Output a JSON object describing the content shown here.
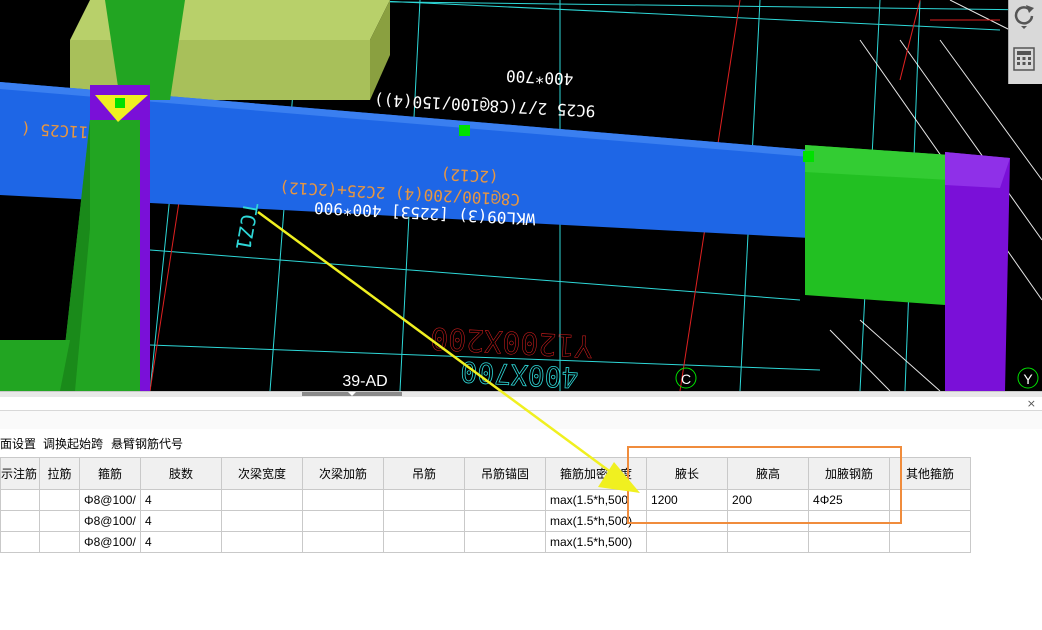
{
  "viewport": {
    "labels": {
      "beam_top_line1": "400*700",
      "beam_top_line2": "9C25 2/7(C8@100/150(4))",
      "beam_left_fragment": "11C25 (",
      "beam_mid_line1": "(2C12)",
      "beam_mid_line2": "C8@100/200(4) 2C25+(2C12)",
      "beam_mid_line3": "WKL09(3) [2253] 400*900",
      "side_text": "TCZ1",
      "lower_line1": "Y1200X200",
      "lower_line2": "400X700",
      "axis_label": "39-AD",
      "axis_c": "C",
      "axis_y": "Y"
    },
    "colors": {
      "beam": "#1e66e6",
      "column_green": "#22a522",
      "column_light": "#a8c05a",
      "column_purple": "#7a10d8",
      "annotation": "#e89640",
      "grid_cyan": "#2ed8d8",
      "grid_red": "#e02020",
      "arrow": "#f0f020"
    }
  },
  "toolbar": {
    "refresh_icon": "refresh-icon",
    "calculator_icon": "calculator-icon"
  },
  "panel": {
    "close_label": "×",
    "menu": [
      "面设置",
      "调换起始跨",
      "悬臂钢筋代号"
    ],
    "headers": [
      "示注筋",
      "拉筋",
      "箍筋",
      "肢数",
      "次梁宽度",
      "次梁加筋",
      "吊筋",
      "吊筋锚固",
      "箍筋加密长度",
      "腋长",
      "腋高",
      "加腋钢筋",
      "其他箍筋"
    ],
    "rows": [
      [
        "",
        "",
        "Φ8@100/",
        "4",
        "",
        "",
        "",
        "",
        "max(1.5*h,500",
        "1200",
        "200",
        "4Φ25",
        ""
      ],
      [
        "",
        "",
        "Φ8@100/",
        "4",
        "",
        "",
        "",
        "",
        "max(1.5*h,500)",
        "",
        "",
        "",
        ""
      ],
      [
        "",
        "",
        "Φ8@100/",
        "4",
        "",
        "",
        "",
        "",
        "max(1.5*h,500)",
        "",
        "",
        "",
        ""
      ]
    ]
  }
}
